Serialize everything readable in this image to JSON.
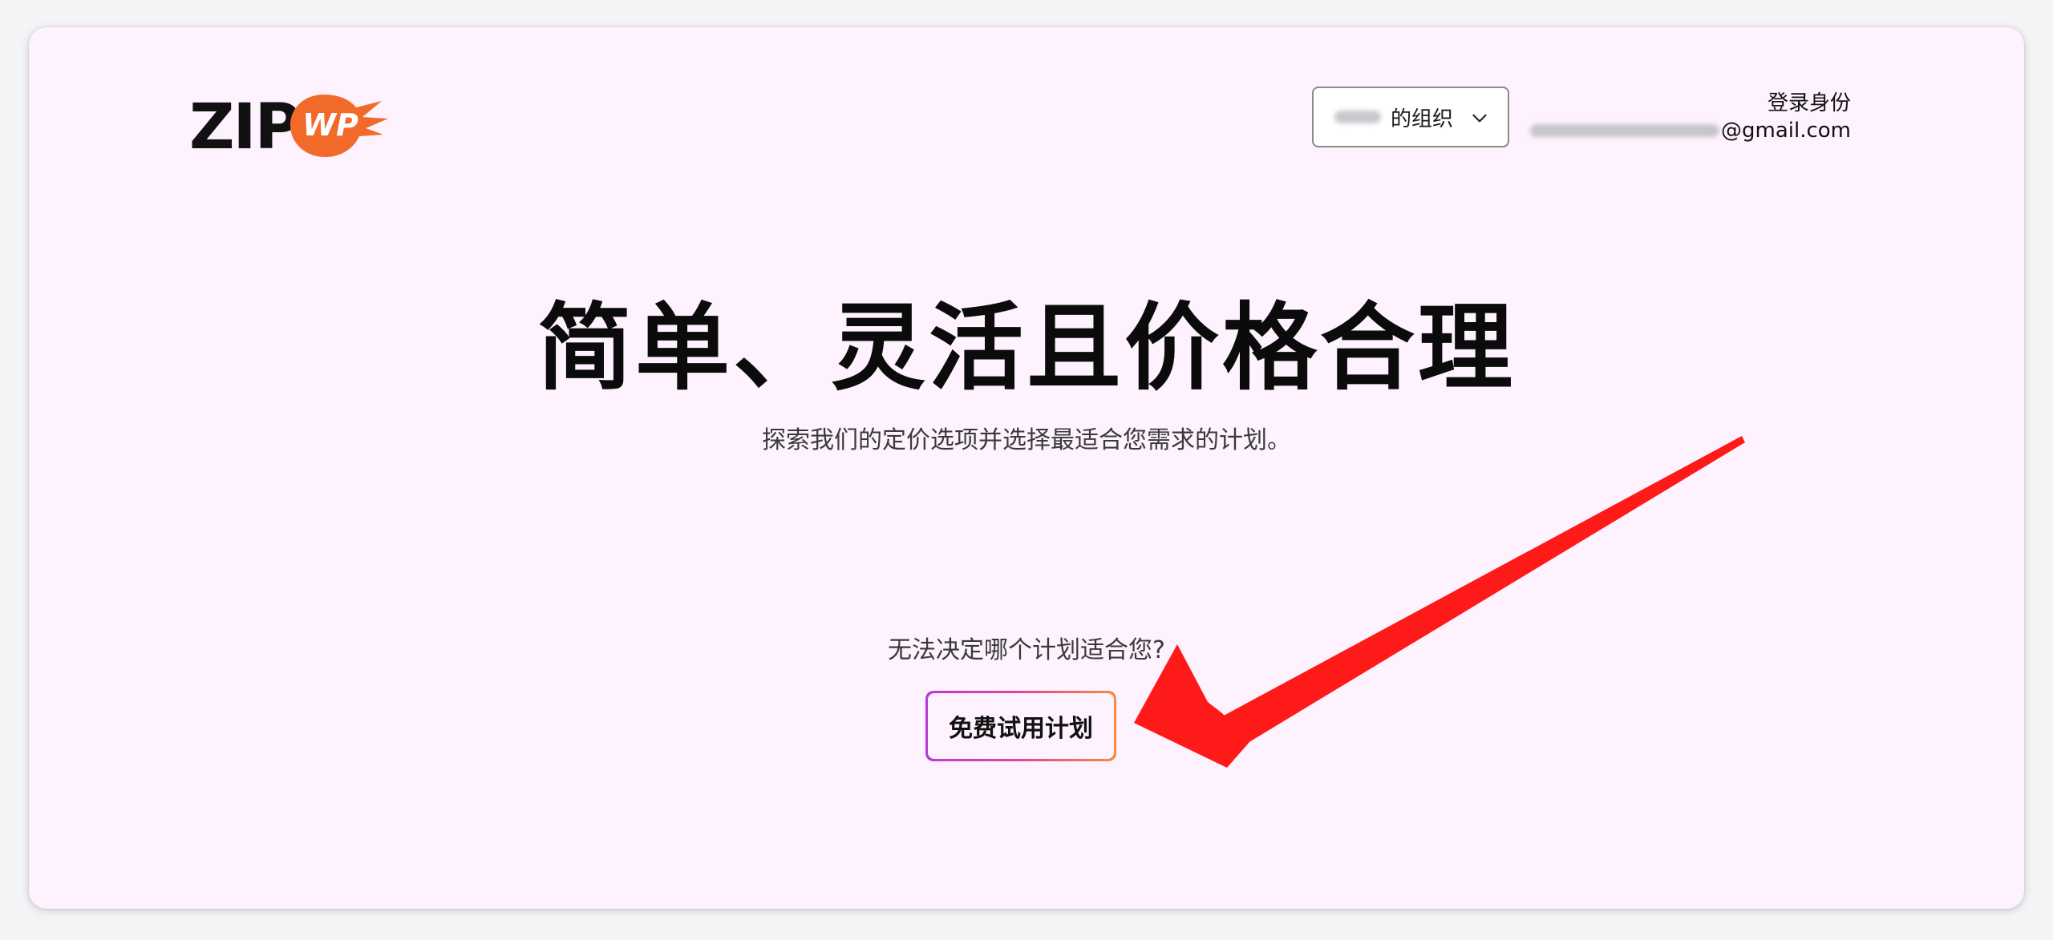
{
  "logo": {
    "left_text": "ZIP",
    "badge_text": "WP",
    "badge_color": "#f26a2a",
    "wordmark_color": "#111111"
  },
  "org_selector": {
    "suffix": "的组织",
    "icon": "chevron-down-icon"
  },
  "account": {
    "login_label": "登录身份",
    "email_domain": "@gmail.com"
  },
  "hero": {
    "title": "简单、灵活且价格合理",
    "subtitle": "探索我们的定价选项并选择最适合您需求的计划。"
  },
  "cta": {
    "question": "无法决定哪个计划适合您?",
    "button_label": "免费试用计划",
    "gradient": [
      "#b83ad8",
      "#e0489a",
      "#f68b3c"
    ]
  },
  "annotation": {
    "arrow_color": "#ff1a1a"
  }
}
